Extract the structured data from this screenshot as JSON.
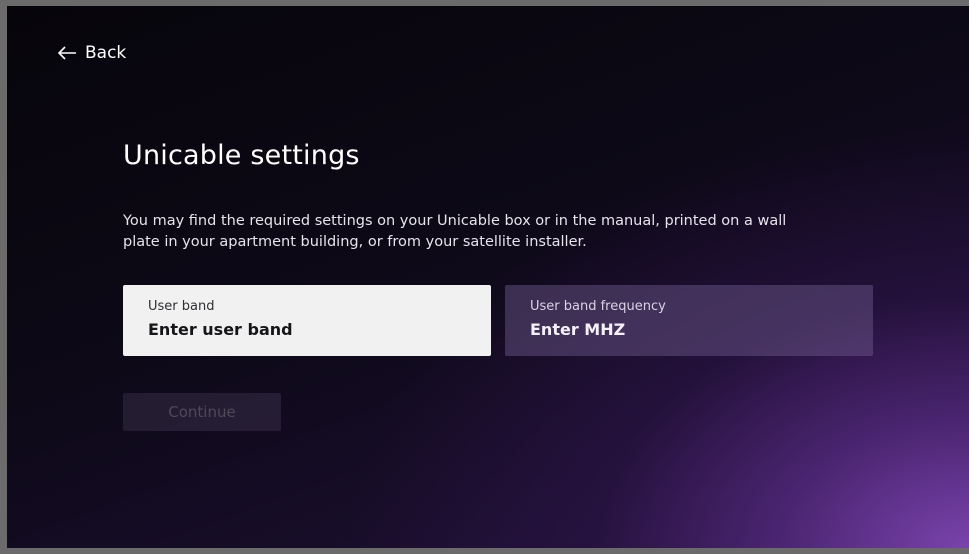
{
  "nav": {
    "back_label": "Back"
  },
  "page": {
    "title": "Unicable settings",
    "description": "You may find the required settings on your Unicable box or in the manual, printed on a wall plate in your apartment building, or from your satellite installer."
  },
  "fields": {
    "user_band": {
      "label": "User band",
      "value": "Enter user band"
    },
    "user_band_frequency": {
      "label": "User band frequency",
      "value": "Enter MHZ"
    }
  },
  "actions": {
    "continue_label": "Continue"
  },
  "theme": {
    "accent": "#7e46b2",
    "background": "#08060d",
    "focused_field": "#f1f1f2",
    "unfocused_field": "#5b4a72"
  }
}
